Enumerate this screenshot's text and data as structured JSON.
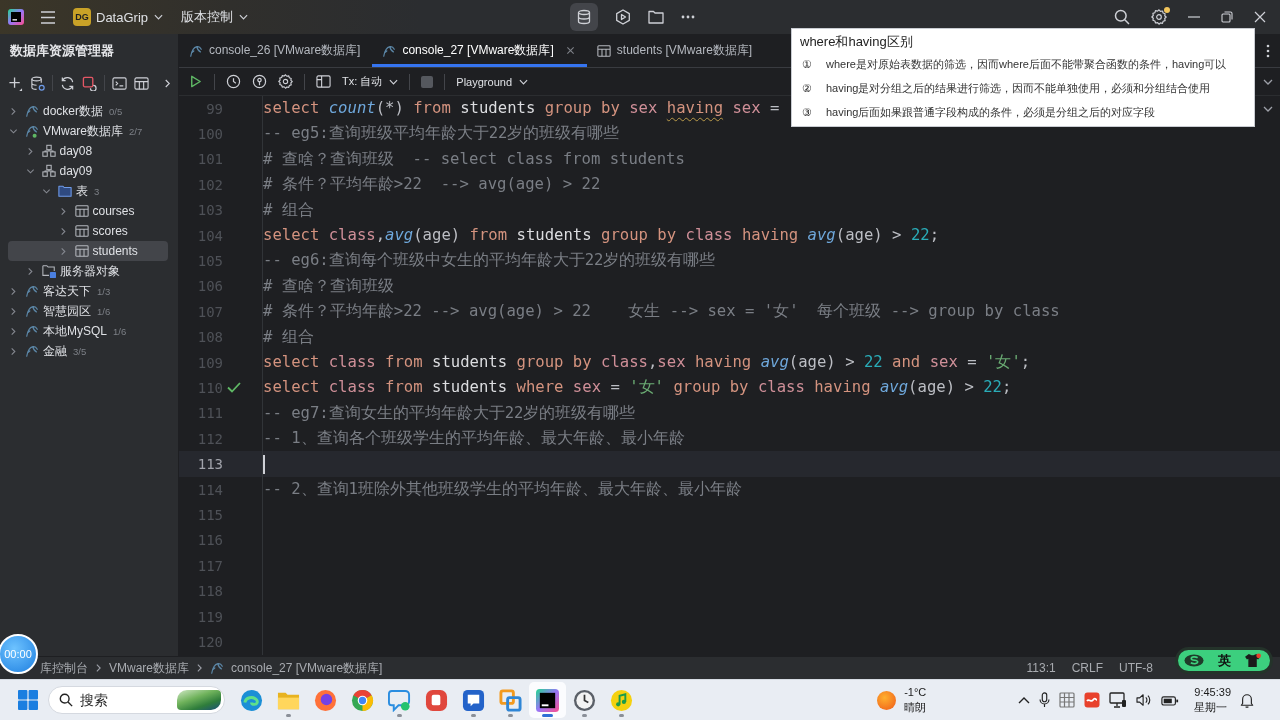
{
  "title_bar": {
    "project": {
      "badge": "DG",
      "name": "DataGrip"
    },
    "vcs_menu": "版本控制",
    "notification": true
  },
  "sidebar": {
    "title": "数据库资源管理器",
    "tree": [
      {
        "label": "docker数据",
        "count": "0/5",
        "kind": "datasource",
        "expanded": false,
        "selected": false,
        "connected": false
      },
      {
        "label": "VMware数据库",
        "count": "2/7",
        "kind": "datasource",
        "expanded": true,
        "selected": false,
        "connected": true,
        "children": [
          {
            "label": "day08",
            "kind": "schema",
            "expanded": false,
            "selected": false
          },
          {
            "label": "day09",
            "kind": "schema",
            "expanded": true,
            "selected": false,
            "children": [
              {
                "label": "表",
                "count": "3",
                "kind": "folder",
                "expanded": true,
                "selected": false,
                "children": [
                  {
                    "label": "courses",
                    "kind": "table",
                    "expanded": false,
                    "selected": false
                  },
                  {
                    "label": "scores",
                    "kind": "table",
                    "expanded": false,
                    "selected": false
                  },
                  {
                    "label": "students",
                    "kind": "table",
                    "expanded": false,
                    "selected": true
                  }
                ]
              }
            ]
          },
          {
            "label": "服务器对象",
            "kind": "server",
            "expanded": false,
            "selected": false
          }
        ]
      },
      {
        "label": "客达天下",
        "count": "1/3",
        "kind": "datasource",
        "expanded": false,
        "selected": false,
        "connected": false
      },
      {
        "label": "智慧园区",
        "count": "1/6",
        "kind": "datasource",
        "expanded": false,
        "selected": false,
        "connected": false
      },
      {
        "label": "本地MySQL",
        "count": "1/6",
        "kind": "datasource",
        "expanded": false,
        "selected": false,
        "connected": false
      },
      {
        "label": "金融",
        "count": "3/5",
        "kind": "datasource",
        "expanded": false,
        "selected": false,
        "connected": false
      }
    ]
  },
  "tabs": [
    {
      "label": "console_26 [VMware数据库]",
      "kind": "console",
      "selected": false
    },
    {
      "label": "console_27 [VMware数据库]",
      "kind": "console",
      "selected": true
    },
    {
      "label": "students [VMware数据库]",
      "kind": "table",
      "selected": false
    }
  ],
  "toolbar": {
    "transaction": "Tx: 自动",
    "session": "Playground"
  },
  "editor": {
    "lines": [
      {
        "number": "99",
        "current": false,
        "executed": false,
        "tokens": [
          {
            "text": "select ",
            "kind": "keyword"
          },
          {
            "text": "count",
            "kind": "function"
          },
          {
            "text": "(*) ",
            "kind": "plain"
          },
          {
            "text": "from ",
            "kind": "keyword"
          },
          {
            "text": "students ",
            "kind": "table"
          },
          {
            "text": "group by ",
            "kind": "keyword"
          },
          {
            "text": "sex ",
            "kind": "column"
          },
          {
            "text": "having",
            "kind": "flagged"
          },
          {
            "text": " sex",
            "kind": "column"
          },
          {
            "text": " =",
            "kind": "plain"
          }
        ]
      },
      {
        "number": "100",
        "current": false,
        "executed": false,
        "tokens": [
          {
            "text": "-- eg5:查询班级平均年龄大于22岁的班级有哪些",
            "kind": "comment"
          }
        ]
      },
      {
        "number": "101",
        "current": false,
        "executed": false,
        "tokens": [
          {
            "text": "# 查啥？查询班级  -- select class from students",
            "kind": "comment"
          }
        ]
      },
      {
        "number": "102",
        "current": false,
        "executed": false,
        "tokens": [
          {
            "text": "# 条件？平均年龄>22  --> avg(age) > 22",
            "kind": "comment"
          }
        ]
      },
      {
        "number": "103",
        "current": false,
        "executed": false,
        "tokens": [
          {
            "text": "# 组合",
            "kind": "comment"
          }
        ]
      },
      {
        "number": "104",
        "current": false,
        "executed": false,
        "tokens": [
          {
            "text": "select ",
            "kind": "keyword"
          },
          {
            "text": "class",
            "kind": "column"
          },
          {
            "text": ",",
            "kind": "plain"
          },
          {
            "text": "avg",
            "kind": "function"
          },
          {
            "text": "(age) ",
            "kind": "plain"
          },
          {
            "text": "from ",
            "kind": "keyword"
          },
          {
            "text": "students ",
            "kind": "table"
          },
          {
            "text": "group by ",
            "kind": "keyword"
          },
          {
            "text": "class ",
            "kind": "column"
          },
          {
            "text": "having ",
            "kind": "keyword"
          },
          {
            "text": "avg",
            "kind": "function"
          },
          {
            "text": "(age) > ",
            "kind": "plain"
          },
          {
            "text": "22",
            "kind": "number"
          },
          {
            "text": ";",
            "kind": "plain"
          }
        ]
      },
      {
        "number": "105",
        "current": false,
        "executed": false,
        "tokens": [
          {
            "text": "-- eg6:查询每个班级中女生的平均年龄大于22岁的班级有哪些",
            "kind": "comment"
          }
        ]
      },
      {
        "number": "106",
        "current": false,
        "executed": false,
        "tokens": [
          {
            "text": "# 查啥？查询班级",
            "kind": "comment"
          }
        ]
      },
      {
        "number": "107",
        "current": false,
        "executed": false,
        "tokens": [
          {
            "text": "# 条件？平均年龄>22 --> avg(age) > 22    女生 --> sex = '女'  每个班级 --> group by class",
            "kind": "comment"
          }
        ]
      },
      {
        "number": "108",
        "current": false,
        "executed": false,
        "tokens": [
          {
            "text": "# 组合",
            "kind": "comment"
          }
        ]
      },
      {
        "number": "109",
        "current": false,
        "executed": false,
        "tokens": [
          {
            "text": "select ",
            "kind": "keyword"
          },
          {
            "text": "class ",
            "kind": "column"
          },
          {
            "text": "from ",
            "kind": "keyword"
          },
          {
            "text": "students ",
            "kind": "table"
          },
          {
            "text": "group by ",
            "kind": "keyword"
          },
          {
            "text": "class",
            "kind": "column"
          },
          {
            "text": ",",
            "kind": "plain"
          },
          {
            "text": "sex ",
            "kind": "column"
          },
          {
            "text": "having ",
            "kind": "keyword"
          },
          {
            "text": "avg",
            "kind": "function"
          },
          {
            "text": "(age) > ",
            "kind": "plain"
          },
          {
            "text": "22 ",
            "kind": "number"
          },
          {
            "text": "and ",
            "kind": "keyword"
          },
          {
            "text": "sex ",
            "kind": "column"
          },
          {
            "text": "= ",
            "kind": "plain"
          },
          {
            "text": "'女'",
            "kind": "string"
          },
          {
            "text": ";",
            "kind": "plain"
          }
        ]
      },
      {
        "number": "110",
        "current": false,
        "executed": true,
        "tokens": [
          {
            "text": "select ",
            "kind": "keyword"
          },
          {
            "text": "class ",
            "kind": "column"
          },
          {
            "text": "from ",
            "kind": "keyword"
          },
          {
            "text": "students ",
            "kind": "table"
          },
          {
            "text": "where ",
            "kind": "keyword"
          },
          {
            "text": "sex ",
            "kind": "column"
          },
          {
            "text": "= ",
            "kind": "plain"
          },
          {
            "text": "'女' ",
            "kind": "string"
          },
          {
            "text": "group by ",
            "kind": "keyword"
          },
          {
            "text": "class ",
            "kind": "column"
          },
          {
            "text": "having ",
            "kind": "keyword"
          },
          {
            "text": "avg",
            "kind": "function"
          },
          {
            "text": "(age) > ",
            "kind": "plain"
          },
          {
            "text": "22",
            "kind": "number"
          },
          {
            "text": ";",
            "kind": "plain"
          }
        ]
      },
      {
        "number": "111",
        "current": false,
        "executed": false,
        "tokens": [
          {
            "text": "-- eg7:查询女生的平均年龄大于22岁的班级有哪些",
            "kind": "comment"
          }
        ]
      },
      {
        "number": "112",
        "current": false,
        "executed": false,
        "tokens": [
          {
            "text": "-- 1、查询各个班级学生的平均年龄、最大年龄、最小年龄",
            "kind": "comment"
          }
        ]
      },
      {
        "number": "113",
        "current": true,
        "executed": false
      },
      {
        "number": "114",
        "current": false,
        "executed": false,
        "tokens": [
          {
            "text": "-- 2、查询1班除外其他班级学生的平均年龄、最大年龄、最小年龄",
            "kind": "comment"
          }
        ]
      },
      {
        "number": "115",
        "current": false,
        "executed": false
      },
      {
        "number": "116",
        "current": false,
        "executed": false
      },
      {
        "number": "117",
        "current": false,
        "executed": false
      },
      {
        "number": "118",
        "current": false,
        "executed": false
      },
      {
        "number": "119",
        "current": false,
        "executed": false
      },
      {
        "number": "120",
        "current": false,
        "executed": false
      }
    ]
  },
  "popup": {
    "title": "where和having区别",
    "items": [
      {
        "number": "①",
        "text": "where是对原始表数据的筛选，因而where后面不能带聚合函数的条件，having可以"
      },
      {
        "number": "②",
        "text": "having是对分组之后的结果进行筛选，因而不能单独使用，必须和分组结合使用"
      },
      {
        "number": "③",
        "text": "having后面如果跟普通字段构成的条件，必须是分组之后的对应字段"
      }
    ]
  },
  "status_bar": {
    "breadcrumb": [
      {
        "label": "库控制台",
        "kind": "text"
      },
      {
        "label": "VMware数据库",
        "kind": "text"
      },
      {
        "label": "console_27 [VMware数据库]",
        "kind": "console"
      }
    ],
    "position": "113:1",
    "line_ending": "CRLF",
    "encoding": "UTF-8"
  },
  "recording_timer": "00:00",
  "ime_toolbar": {
    "mode": "英"
  },
  "taskbar": {
    "search": {
      "placeholder": "搜索"
    },
    "apps": [
      {
        "kind": "swirl",
        "running": false,
        "active": false
      },
      {
        "kind": "folder",
        "running": true,
        "active": false
      },
      {
        "kind": "fox",
        "running": false,
        "active": false
      },
      {
        "kind": "ring",
        "running": false,
        "active": false
      },
      {
        "kind": "chat",
        "running": true,
        "active": false
      },
      {
        "kind": "tile",
        "running": false,
        "active": false
      },
      {
        "kind": "message",
        "running": true,
        "active": false
      },
      {
        "kind": "squares",
        "running": true,
        "active": false
      },
      {
        "kind": "logo",
        "running": true,
        "active": true
      },
      {
        "kind": "clock",
        "running": true,
        "active": false
      },
      {
        "kind": "music",
        "running": true,
        "active": false
      }
    ],
    "weather": {
      "temperature": "-1°C",
      "condition": "晴朗"
    },
    "clock": {
      "time": "9:45:39",
      "day": "星期一"
    }
  }
}
